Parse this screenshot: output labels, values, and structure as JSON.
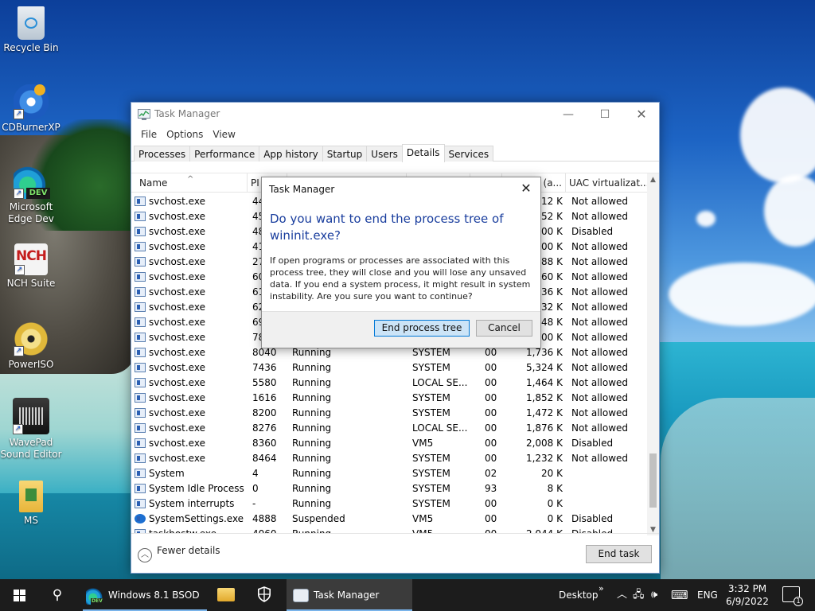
{
  "desktop": {
    "icons": [
      {
        "label": "Recycle Bin"
      },
      {
        "label": "CDBurnerXP"
      },
      {
        "label": "Microsoft Edge Dev",
        "badge": "DEV"
      },
      {
        "label": "NCH Suite",
        "badge": "NCH"
      },
      {
        "label": "PowerISO"
      },
      {
        "label": "WavePad Sound Editor"
      },
      {
        "label": "MS"
      }
    ]
  },
  "task_manager": {
    "title": "Task Manager",
    "menu": [
      "File",
      "Options",
      "View"
    ],
    "tabs": [
      "Processes",
      "Performance",
      "App history",
      "Startup",
      "Users",
      "Details",
      "Services"
    ],
    "active_tab": "Details",
    "columns": {
      "name": "Name",
      "pid": "PI",
      "memory": "y (a...",
      "uac": "UAC virtualizat..."
    },
    "rows": [
      {
        "name": "svchost.exe",
        "pid": "44",
        "status": "",
        "user": "",
        "cpu": "",
        "mem": "12 K",
        "uac": "Not allowed"
      },
      {
        "name": "svchost.exe",
        "pid": "45",
        "status": "",
        "user": "",
        "cpu": "",
        "mem": "52 K",
        "uac": "Not allowed"
      },
      {
        "name": "svchost.exe",
        "pid": "48",
        "status": "",
        "user": "",
        "cpu": "",
        "mem": "00 K",
        "uac": "Disabled"
      },
      {
        "name": "svchost.exe",
        "pid": "41",
        "status": "",
        "user": "",
        "cpu": "",
        "mem": "00 K",
        "uac": "Not allowed"
      },
      {
        "name": "svchost.exe",
        "pid": "27",
        "status": "",
        "user": "",
        "cpu": "",
        "mem": "88 K",
        "uac": "Not allowed"
      },
      {
        "name": "svchost.exe",
        "pid": "60",
        "status": "",
        "user": "",
        "cpu": "",
        "mem": "60 K",
        "uac": "Not allowed"
      },
      {
        "name": "svchost.exe",
        "pid": "61",
        "status": "",
        "user": "",
        "cpu": "",
        "mem": "36 K",
        "uac": "Not allowed"
      },
      {
        "name": "svchost.exe",
        "pid": "62",
        "status": "",
        "user": "",
        "cpu": "",
        "mem": "32 K",
        "uac": "Not allowed"
      },
      {
        "name": "svchost.exe",
        "pid": "69",
        "status": "",
        "user": "",
        "cpu": "",
        "mem": "48 K",
        "uac": "Not allowed"
      },
      {
        "name": "svchost.exe",
        "pid": "78",
        "status": "",
        "user": "",
        "cpu": "",
        "mem": "00 K",
        "uac": "Not allowed"
      },
      {
        "name": "svchost.exe",
        "pid": "8040",
        "status": "Running",
        "user": "SYSTEM",
        "cpu": "00",
        "mem": "1,736 K",
        "uac": "Not allowed"
      },
      {
        "name": "svchost.exe",
        "pid": "7436",
        "status": "Running",
        "user": "SYSTEM",
        "cpu": "00",
        "mem": "5,324 K",
        "uac": "Not allowed"
      },
      {
        "name": "svchost.exe",
        "pid": "5580",
        "status": "Running",
        "user": "LOCAL SE...",
        "cpu": "00",
        "mem": "1,464 K",
        "uac": "Not allowed"
      },
      {
        "name": "svchost.exe",
        "pid": "1616",
        "status": "Running",
        "user": "SYSTEM",
        "cpu": "00",
        "mem": "1,852 K",
        "uac": "Not allowed"
      },
      {
        "name": "svchost.exe",
        "pid": "8200",
        "status": "Running",
        "user": "SYSTEM",
        "cpu": "00",
        "mem": "1,472 K",
        "uac": "Not allowed"
      },
      {
        "name": "svchost.exe",
        "pid": "8276",
        "status": "Running",
        "user": "LOCAL SE...",
        "cpu": "00",
        "mem": "1,876 K",
        "uac": "Not allowed"
      },
      {
        "name": "svchost.exe",
        "pid": "8360",
        "status": "Running",
        "user": "VM5",
        "cpu": "00",
        "mem": "2,008 K",
        "uac": "Disabled"
      },
      {
        "name": "svchost.exe",
        "pid": "8464",
        "status": "Running",
        "user": "SYSTEM",
        "cpu": "00",
        "mem": "1,232 K",
        "uac": "Not allowed"
      },
      {
        "name": "System",
        "pid": "4",
        "status": "Running",
        "user": "SYSTEM",
        "cpu": "02",
        "mem": "20 K",
        "uac": ""
      },
      {
        "name": "System Idle Process",
        "pid": "0",
        "status": "Running",
        "user": "SYSTEM",
        "cpu": "93",
        "mem": "8 K",
        "uac": ""
      },
      {
        "name": "System interrupts",
        "pid": "-",
        "status": "Running",
        "user": "SYSTEM",
        "cpu": "00",
        "mem": "0 K",
        "uac": ""
      },
      {
        "name": "SystemSettings.exe",
        "pid": "4888",
        "status": "Suspended",
        "user": "VM5",
        "cpu": "00",
        "mem": "0 K",
        "uac": "Disabled",
        "icon": "gear"
      },
      {
        "name": "taskhostw.exe",
        "pid": "4060",
        "status": "Running",
        "user": "VM5",
        "cpu": "00",
        "mem": "2,044 K",
        "uac": "Disabled"
      }
    ],
    "fewer_details": "Fewer details",
    "end_task": "End task"
  },
  "dialog": {
    "title": "Task Manager",
    "question": "Do you want to end the process tree of wininit.exe?",
    "body": "If open programs or processes are associated with this process tree, they will close and you will lose any unsaved data. If you end a system process, it might result in system instability. Are you sure you want to continue?",
    "primary": "End process tree",
    "cancel": "Cancel"
  },
  "taskbar": {
    "apps": [
      {
        "label": "Windows 8.1 BSOD ...",
        "badge": "DEV"
      },
      {
        "label": "Task Manager"
      }
    ],
    "tray": {
      "desktop": "Desktop",
      "language": "ENG",
      "time": "3:32 PM",
      "date": "6/9/2022",
      "notifications": "1"
    }
  }
}
